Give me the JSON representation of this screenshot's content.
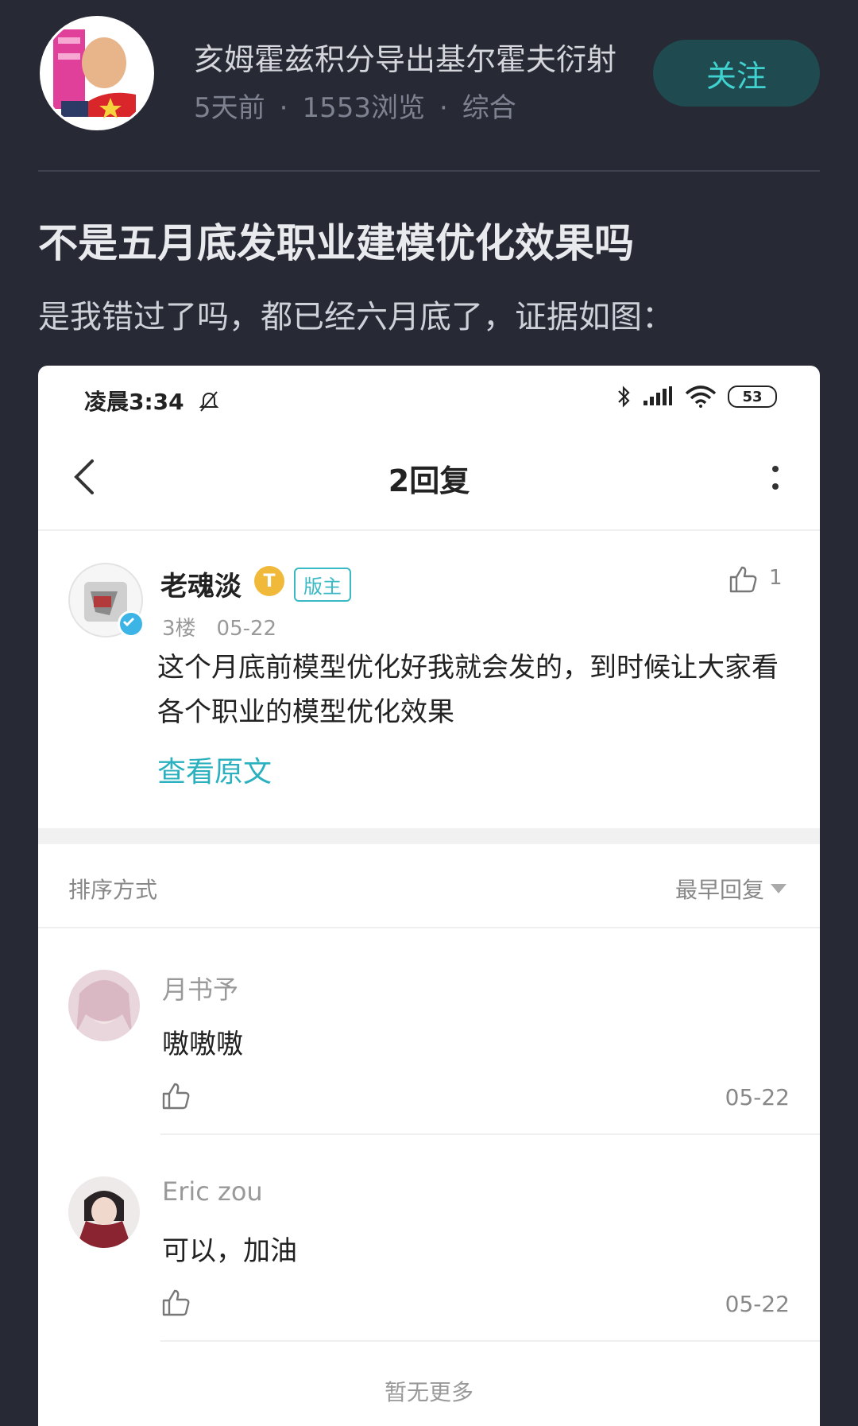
{
  "post": {
    "author": "亥姆霍兹积分导出基尔霍夫衍射",
    "time": "5天前",
    "views": "1553浏览",
    "category": "综合",
    "follow_label": "关注",
    "title": "不是五月底发职业建模优化效果吗",
    "body": "是我错过了吗，都已经六月底了，证据如图："
  },
  "screenshot": {
    "status_time": "凌晨3:34",
    "battery": "53",
    "nav_title": "2回复",
    "op": {
      "name": "老魂淡",
      "level": "T",
      "badge": "版主",
      "likes": "1",
      "floor": "3楼",
      "date": "05-22",
      "content": "这个月底前模型优化好我就会发的，到时候让大家看各个职业的模型优化效果",
      "view_original": "查看原文"
    },
    "sort": {
      "label": "排序方式",
      "value": "最早回复"
    },
    "replies": [
      {
        "name": "月书予",
        "text": "嗷嗷嗷",
        "date": "05-22"
      },
      {
        "name": "Eric zou",
        "text": "可以，加油",
        "date": "05-22"
      }
    ],
    "no_more": "暂无更多"
  },
  "colors": {
    "accent": "#3fd2cf",
    "follow_bg": "#1f4b50",
    "page_bg": "#272a35",
    "link": "#2ab0be",
    "badge_gold": "#f0b93a"
  }
}
